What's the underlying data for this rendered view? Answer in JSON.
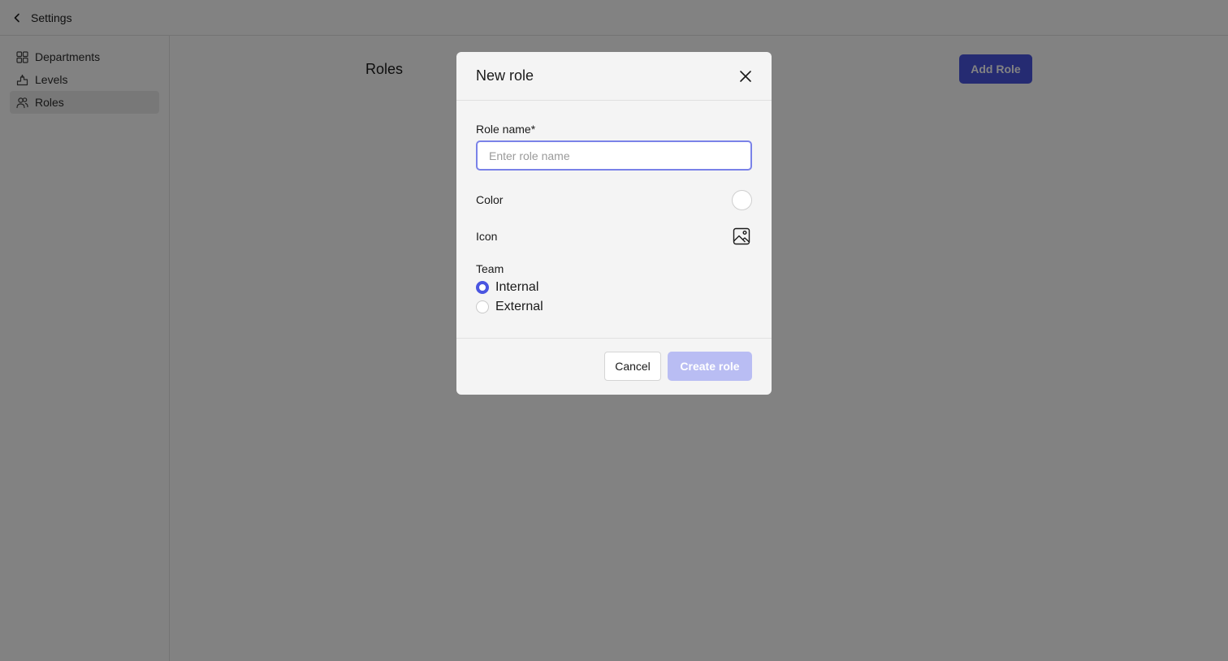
{
  "topbar": {
    "back_label": "Settings"
  },
  "sidebar": {
    "items": [
      {
        "label": "Departments",
        "icon": "grid-icon",
        "active": false
      },
      {
        "label": "Levels",
        "icon": "levels-icon",
        "active": false
      },
      {
        "label": "Roles",
        "icon": "users-icon",
        "active": true
      }
    ]
  },
  "main": {
    "title": "Roles",
    "add_button_label": "Add Role"
  },
  "modal": {
    "title": "New role",
    "role_name_label": "Role name*",
    "role_name_value": "",
    "role_name_placeholder": "Enter role name",
    "color_label": "Color",
    "icon_label": "Icon",
    "team_label": "Team",
    "team_options": [
      {
        "label": "Internal",
        "selected": true
      },
      {
        "label": "External",
        "selected": false
      }
    ],
    "cancel_label": "Cancel",
    "create_label": "Create role"
  },
  "colors": {
    "accent": "#4a55e0",
    "accent_disabled": "#b9bdf3",
    "input_focus_border": "#7a82e8"
  }
}
